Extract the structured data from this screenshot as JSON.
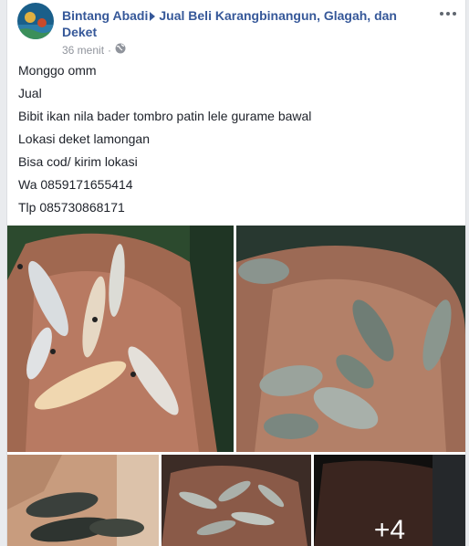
{
  "post": {
    "author": "Bintang Abadi",
    "group": "Jual Beli Karangbinangun, Glagah, dan Deket",
    "time": "36 menit",
    "separator": "·"
  },
  "body_lines": [
    "Monggo omm",
    "Jual",
    "Bibit ikan nila bader tombro patin lele gurame bawal",
    "Lokasi deket lamongan",
    "Bisa cod/ kirim lokasi",
    "Wa 0859171655414",
    "Tlp 085730868171"
  ],
  "photos": {
    "more_count": "+4"
  },
  "icons": [
    "more-options-icon",
    "globe-icon",
    "group-arrow-icon"
  ],
  "colors": {
    "link": "#365899",
    "meta": "#90949c",
    "text": "#1d2129"
  }
}
